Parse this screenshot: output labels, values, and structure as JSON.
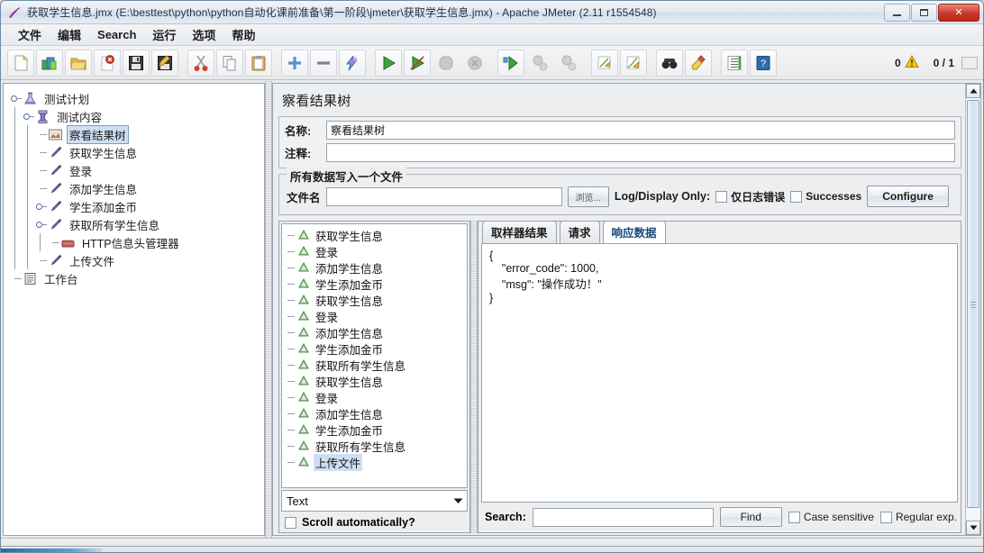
{
  "window": {
    "title": "获取学生信息.jmx (E:\\besttest\\python\\python自动化课前准备\\第一阶段\\jmeter\\获取学生信息.jmx) - Apache JMeter (2.11 r1554548)",
    "app_icon": "jmeter-feather-icon",
    "minimize_label": "",
    "maximize_label": "",
    "close_label": "✕"
  },
  "menubar": {
    "items": [
      {
        "label": "文件",
        "name": "menu-file"
      },
      {
        "label": "编辑",
        "name": "menu-edit"
      },
      {
        "label": "Search",
        "name": "menu-search"
      },
      {
        "label": "运行",
        "name": "menu-run"
      },
      {
        "label": "选项",
        "name": "menu-options"
      },
      {
        "label": "帮助",
        "name": "menu-help"
      }
    ]
  },
  "toolbar": {
    "buttons": [
      {
        "icon": "new-document-icon",
        "name": "toolbar-new"
      },
      {
        "icon": "templates-icon",
        "name": "toolbar-templates"
      },
      {
        "icon": "open-folder-icon",
        "name": "toolbar-open"
      },
      {
        "icon": "close-icon",
        "name": "toolbar-close"
      },
      {
        "icon": "save-icon",
        "name": "toolbar-save"
      },
      {
        "icon": "save-as-icon",
        "name": "toolbar-save-as"
      },
      {
        "icon": "cut-icon",
        "name": "toolbar-cut"
      },
      {
        "icon": "copy-icon",
        "name": "toolbar-copy"
      },
      {
        "icon": "paste-icon",
        "name": "toolbar-paste"
      },
      {
        "icon": "expand-icon",
        "name": "toolbar-expand"
      },
      {
        "icon": "collapse-icon",
        "name": "toolbar-collapse"
      },
      {
        "icon": "toggle-icon",
        "name": "toolbar-toggle"
      },
      {
        "icon": "start-icon",
        "name": "toolbar-start"
      },
      {
        "icon": "start-no-pauses-icon",
        "name": "toolbar-start-no-pauses"
      },
      {
        "icon": "stop-icon",
        "name": "toolbar-stop"
      },
      {
        "icon": "shutdown-icon",
        "name": "toolbar-shutdown"
      },
      {
        "icon": "remote-start-icon",
        "name": "toolbar-remote-start"
      },
      {
        "icon": "remote-stop-icon",
        "name": "toolbar-remote-stop"
      },
      {
        "icon": "remote-shutdown-icon",
        "name": "toolbar-remote-shutdown"
      },
      {
        "icon": "clear-icon",
        "name": "toolbar-clear"
      },
      {
        "icon": "clear-all-icon",
        "name": "toolbar-clear-all"
      },
      {
        "icon": "search-icon",
        "name": "toolbar-search"
      },
      {
        "icon": "search-reset-icon",
        "name": "toolbar-search-reset"
      },
      {
        "icon": "function-helper-icon",
        "name": "toolbar-function-helper"
      },
      {
        "icon": "help-icon",
        "name": "toolbar-help"
      }
    ],
    "warning_count": "0",
    "warning_icon": "warning-triangle-icon",
    "thread_count": "0 / 1"
  },
  "tree": {
    "nodes": [
      {
        "label": "测试计划",
        "icon": "test-plan-icon",
        "depth": 0,
        "expander": true,
        "selected": false
      },
      {
        "label": "测试内容",
        "icon": "thread-group-icon",
        "depth": 1,
        "expander": true,
        "selected": false
      },
      {
        "label": "察看结果树",
        "icon": "view-results-tree-icon",
        "depth": 2,
        "expander": false,
        "selected": true
      },
      {
        "label": "获取学生信息",
        "icon": "http-sampler-icon",
        "depth": 2,
        "expander": false,
        "selected": false
      },
      {
        "label": "登录",
        "icon": "http-sampler-icon",
        "depth": 2,
        "expander": false,
        "selected": false
      },
      {
        "label": "添加学生信息",
        "icon": "http-sampler-icon",
        "depth": 2,
        "expander": false,
        "selected": false
      },
      {
        "label": "学生添加金币",
        "icon": "http-sampler-icon",
        "depth": 2,
        "expander": true,
        "selected": false
      },
      {
        "label": "获取所有学生信息",
        "icon": "http-sampler-icon",
        "depth": 2,
        "expander": true,
        "selected": false
      },
      {
        "label": "HTTP信息头管理器",
        "icon": "header-manager-icon",
        "depth": 3,
        "expander": false,
        "selected": false
      },
      {
        "label": "上传文件",
        "icon": "http-sampler-icon",
        "depth": 2,
        "expander": false,
        "selected": false
      },
      {
        "label": "工作台",
        "icon": "workbench-icon",
        "depth": 0,
        "expander": false,
        "selected": false
      }
    ]
  },
  "panel": {
    "title": "察看结果树",
    "name_label": "名称:",
    "name_value": "察看结果树",
    "comment_label": "注释:",
    "comment_value": "",
    "group": {
      "title": "所有数据写入一个文件",
      "filename_label": "文件名",
      "filename_value": "",
      "filename_placeholder": "",
      "browse_label": "浏览...",
      "log_display_label": "Log/Display Only:",
      "errors_only_label": "仅日志错误",
      "errors_only_checked": false,
      "successes_label": "Successes",
      "successes_checked": false,
      "configure_label": "Configure"
    }
  },
  "results": {
    "items": [
      {
        "label": "获取学生信息",
        "icon": "success-result-icon",
        "selected": false
      },
      {
        "label": "登录",
        "icon": "success-result-icon",
        "selected": false
      },
      {
        "label": "添加学生信息",
        "icon": "success-result-icon",
        "selected": false
      },
      {
        "label": "学生添加金币",
        "icon": "success-result-icon",
        "selected": false
      },
      {
        "label": "获取学生信息",
        "icon": "success-result-icon",
        "selected": false
      },
      {
        "label": "登录",
        "icon": "success-result-icon",
        "selected": false
      },
      {
        "label": "添加学生信息",
        "icon": "success-result-icon",
        "selected": false
      },
      {
        "label": "学生添加金币",
        "icon": "success-result-icon",
        "selected": false
      },
      {
        "label": "获取所有学生信息",
        "icon": "success-result-icon",
        "selected": false
      },
      {
        "label": "获取学生信息",
        "icon": "success-result-icon",
        "selected": false
      },
      {
        "label": "登录",
        "icon": "success-result-icon",
        "selected": false
      },
      {
        "label": "添加学生信息",
        "icon": "success-result-icon",
        "selected": false
      },
      {
        "label": "学生添加金币",
        "icon": "success-result-icon",
        "selected": false
      },
      {
        "label": "获取所有学生信息",
        "icon": "success-result-icon",
        "selected": false
      },
      {
        "label": "上传文件",
        "icon": "success-result-icon",
        "selected": true
      }
    ],
    "renderer_selected": "Text",
    "renderer_options": [
      "Text"
    ],
    "scroll_label": "Scroll automatically?",
    "scroll_checked": false
  },
  "detail": {
    "tabs": [
      {
        "label": "取样器结果",
        "active": false
      },
      {
        "label": "请求",
        "active": false
      },
      {
        "label": "响应数据",
        "active": true
      }
    ],
    "response_body": "{\n    \"error_code\": 1000,\n    \"msg\": \"操作成功！\"\n}",
    "search": {
      "label": "Search:",
      "value": "",
      "placeholder": "",
      "find_label": "Find",
      "case_sensitive_label": "Case sensitive",
      "case_sensitive_checked": false,
      "regex_label": "Regular exp.",
      "regex_checked": false
    }
  },
  "colors": {
    "accent": "#2a6b9e",
    "selection": "#cfdff2",
    "close_button": "#c8382a",
    "warning": "#f5c518"
  }
}
